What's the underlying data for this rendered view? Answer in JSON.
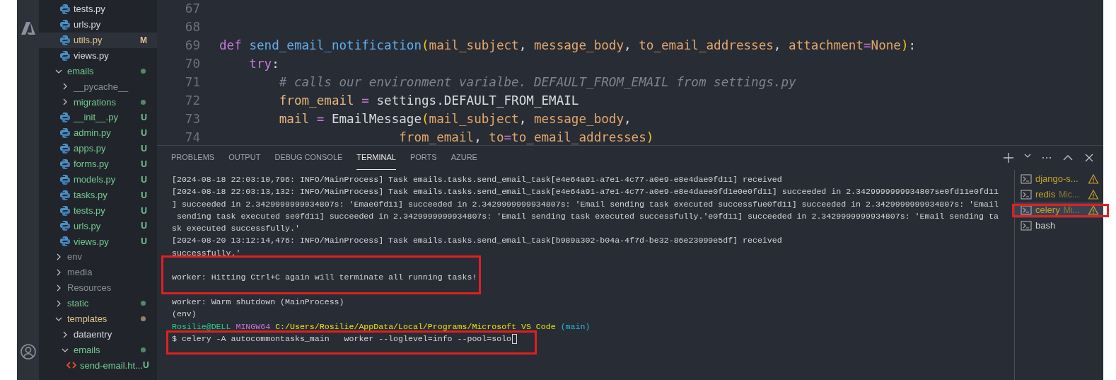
{
  "activity_bar": {
    "items": [
      {
        "kind": "azure"
      },
      {
        "kind": "account"
      }
    ]
  },
  "explorer": {
    "tree": [
      {
        "children": [
          {
            "name": "tests.py",
            "kind": "python",
            "color": "#d7dae0",
            "selected": false
          },
          {
            "name": "urls.py",
            "kind": "python",
            "color": "#d7dae0",
            "selected": false
          },
          {
            "name": "utils.py",
            "kind": "python",
            "color": "#e2c08d",
            "badge": "M",
            "selected": true
          },
          {
            "name": "views.py",
            "kind": "python",
            "color": "#d7dae0",
            "selected": false
          }
        ]
      },
      {
        "name": "emails",
        "kind": "folder",
        "expanded": true,
        "color": "#73c991",
        "dot": true,
        "selected": false,
        "children": [
          {
            "name": "__pycache__",
            "kind": "folder",
            "expanded": false,
            "color": "#8c9099",
            "selected": false
          },
          {
            "name": "migrations",
            "kind": "folder",
            "expanded": false,
            "color": "#73c991",
            "dot": true,
            "selected": false
          },
          {
            "name": "__init__.py",
            "kind": "python",
            "color": "#73c991",
            "badge": "U",
            "selected": false
          },
          {
            "name": "admin.py",
            "kind": "python",
            "color": "#73c991",
            "badge": "U",
            "selected": false
          },
          {
            "name": "apps.py",
            "kind": "python",
            "color": "#73c991",
            "badge": "U",
            "selected": false
          },
          {
            "name": "forms.py",
            "kind": "python",
            "color": "#73c991",
            "badge": "U",
            "selected": false
          },
          {
            "name": "models.py",
            "kind": "python",
            "color": "#73c991",
            "badge": "U",
            "selected": false
          },
          {
            "name": "tasks.py",
            "kind": "python",
            "color": "#73c991",
            "badge": "U",
            "selected": false
          },
          {
            "name": "tests.py",
            "kind": "python",
            "color": "#73c991",
            "badge": "U",
            "selected": false
          },
          {
            "name": "urls.py",
            "kind": "python",
            "color": "#73c991",
            "badge": "U",
            "selected": false
          },
          {
            "name": "views.py",
            "kind": "python",
            "color": "#73c991",
            "badge": "U",
            "selected": false
          }
        ]
      },
      {
        "name": "env",
        "kind": "folder",
        "expanded": false,
        "color": "#8c9099",
        "selected": false
      },
      {
        "name": "media",
        "kind": "folder",
        "expanded": false,
        "color": "#8c9099",
        "selected": false
      },
      {
        "name": "Resources",
        "kind": "folder",
        "expanded": false,
        "color": "#8c9099",
        "selected": false
      },
      {
        "name": "static",
        "kind": "folder",
        "expanded": false,
        "color": "#73c991",
        "dot": true,
        "selected": false
      },
      {
        "name": "templates",
        "kind": "folder",
        "expanded": true,
        "color": "#e2c08d",
        "dot": true,
        "selected": false,
        "children": [
          {
            "name": "dataentry",
            "kind": "folder",
            "expanded": false,
            "color": "#d7dae0",
            "selected": false
          },
          {
            "name": "emails",
            "kind": "folder",
            "expanded": true,
            "color": "#73c991",
            "dot": true,
            "selected": false,
            "children": [
              {
                "name": "send-email.ht...",
                "kind": "html",
                "color": "#73c991",
                "badge": "U",
                "selected": false
              }
            ]
          }
        ]
      }
    ]
  },
  "editor": {
    "lines": [
      {
        "number": "67"
      },
      {
        "number": "68"
      },
      {
        "number": "69",
        "tokens": [
          {
            "kind": "keyword",
            "text": "def "
          },
          {
            "kind": "function",
            "text": "send_email_notification"
          },
          {
            "kind": "bracket",
            "text": "("
          },
          {
            "kind": "param",
            "text": "mail_subject"
          },
          {
            "kind": "plain",
            "text": ", "
          },
          {
            "kind": "param",
            "text": "message_body"
          },
          {
            "kind": "plain",
            "text": ", "
          },
          {
            "kind": "param",
            "text": "to_email_addresses"
          },
          {
            "kind": "plain",
            "text": ", "
          },
          {
            "kind": "param",
            "text": "attachment"
          },
          {
            "kind": "operator",
            "text": "="
          },
          {
            "kind": "constant",
            "text": "None"
          },
          {
            "kind": "bracket",
            "text": ")"
          },
          {
            "kind": "plain",
            "text": ":"
          }
        ]
      },
      {
        "number": "70",
        "tokens": [
          {
            "kind": "keyword",
            "text": "    try"
          },
          {
            "kind": "plain",
            "text": ":"
          }
        ]
      },
      {
        "number": "71",
        "tokens": [
          {
            "kind": "comment",
            "text": "        # calls our environment varialbe. DEFAULT_FROM_EMAIL from settings.py"
          }
        ]
      },
      {
        "number": "72",
        "tokens": [
          {
            "kind": "variable",
            "text": "        from_email"
          },
          {
            "kind": "operator",
            "text": " = "
          },
          {
            "kind": "plain",
            "text": "settings.DEFAULT_FROM_EMAIL"
          }
        ]
      },
      {
        "number": "73",
        "tokens": [
          {
            "kind": "variable",
            "text": "        mail"
          },
          {
            "kind": "operator",
            "text": " = "
          },
          {
            "kind": "class",
            "text": "EmailMessage"
          },
          {
            "kind": "bracket",
            "text": "("
          },
          {
            "kind": "param",
            "text": "mail_subject"
          },
          {
            "kind": "plain",
            "text": ", "
          },
          {
            "kind": "param",
            "text": "message_body"
          },
          {
            "kind": "plain",
            "text": ","
          }
        ]
      },
      {
        "number": "74",
        "tokens": [
          {
            "kind": "param",
            "text": "                        from_email"
          },
          {
            "kind": "plain",
            "text": ", "
          },
          {
            "kind": "param",
            "text": "to"
          },
          {
            "kind": "operator",
            "text": "="
          },
          {
            "kind": "param",
            "text": "to_email_addresses"
          },
          {
            "kind": "bracket",
            "text": ")"
          }
        ]
      }
    ]
  },
  "panel": {
    "tabs": [
      {
        "label": "PROBLEMS",
        "selected": false
      },
      {
        "label": "OUTPUT",
        "selected": false
      },
      {
        "label": "DEBUG CONSOLE",
        "selected": false
      },
      {
        "label": "TERMINAL",
        "selected": true
      },
      {
        "label": "PORTS",
        "selected": false
      },
      {
        "label": "AZURE",
        "selected": false
      }
    ],
    "actions": [
      {
        "kind": "plus"
      },
      {
        "kind": "chevron"
      },
      {
        "kind": "more"
      },
      {
        "kind": "maximize"
      },
      {
        "kind": "close"
      }
    ],
    "terminal_lines": [
      {
        "kind": "output",
        "highlighted": false,
        "segments": [
          {
            "kind": "plain",
            "text": "[2024-08-18 22:03:10,796: INFO/MainProcess] Task emails.tasks.send_email_task[e4e64a91-a7e1-4c77-a0e9-e8e4dae0fd11] received"
          }
        ]
      },
      {
        "kind": "output",
        "highlighted": false,
        "segments": [
          {
            "kind": "plain",
            "text": "[2024-08-18 22:03:13,132: INFO/MainProcess] Task emails.tasks.send_email_task[e4e64a91-a7e1-4c77-a0e9-e8e4daee0fd1e0e0fd11] succeeded in 2.3429999999934807se0fd11e0fd11"
          }
        ]
      },
      {
        "kind": "output",
        "highlighted": false,
        "segments": [
          {
            "kind": "plain",
            "text": "] succeeded in 2.3429999999934807s: 'Emae0fd11] succeeded in 2.3429999999934807s: 'Email sending task executed successfue0fd11] succeeded in 2.3429999999934807s: 'Email"
          }
        ]
      },
      {
        "kind": "output",
        "highlighted": false,
        "segments": [
          {
            "kind": "plain",
            "text": " sending task executed se0fd11] succeeded in 2.3429999999934807s: 'Email sending task executed successfully.'e0fd11] succeeded in 2.3429999999934807s: 'Email sending ta"
          }
        ]
      },
      {
        "kind": "output",
        "highlighted": false,
        "segments": [
          {
            "kind": "plain",
            "text": "sk executed successfully.'"
          }
        ]
      },
      {
        "kind": "output",
        "highlighted": false,
        "segments": [
          {
            "kind": "plain",
            "text": "[2024-08-20 13:12:14,476: INFO/MainProcess] Task emails.tasks.send_email_task[b989a302-b04a-4f7d-be32-86e23099e5df] received"
          }
        ]
      },
      {
        "kind": "output",
        "highlighted": false,
        "segments": [
          {
            "kind": "plain",
            "text": "successfully.'"
          }
        ]
      },
      {
        "kind": "blank"
      },
      {
        "kind": "output",
        "highlighted": true,
        "segments": [
          {
            "kind": "plain",
            "text": "worker: Hitting Ctrl+C again will terminate all running tasks!"
          }
        ]
      },
      {
        "kind": "blank"
      },
      {
        "kind": "output",
        "highlighted": false,
        "segments": [
          {
            "kind": "plain",
            "text": "worker: Warm shutdown (MainProcess)"
          }
        ]
      },
      {
        "kind": "output",
        "highlighted": false,
        "segments": [
          {
            "kind": "plain",
            "text": "(env)"
          }
        ]
      },
      {
        "kind": "output",
        "highlighted": false,
        "segments": [
          {
            "kind": "user",
            "text": "Rosilie@DELL "
          },
          {
            "kind": "system",
            "text": "MINGW64 "
          },
          {
            "kind": "path",
            "text": "C:/Users/Rosilie/AppData/Local/Programs/Microsoft VS Code "
          },
          {
            "kind": "branch",
            "text": "(main)"
          }
        ]
      },
      {
        "kind": "output",
        "highlighted": true,
        "cursor": true,
        "segments": [
          {
            "kind": "plain",
            "text": "$ celery -A autocommontasks_main   worker --loglevel=info --pool=solo"
          }
        ]
      }
    ],
    "terminals": [
      {
        "label": "django-s...",
        "warning": true,
        "selected": false,
        "highlighted": false
      },
      {
        "label": "redis",
        "detail": "Mic...",
        "warning": true,
        "selected": false,
        "highlighted": false
      },
      {
        "label": "celery",
        "detail": "Mi...",
        "warning": true,
        "selected": true,
        "highlighted": true
      },
      {
        "label": "bash",
        "warning": false,
        "selected": false,
        "highlighted": false
      }
    ]
  }
}
